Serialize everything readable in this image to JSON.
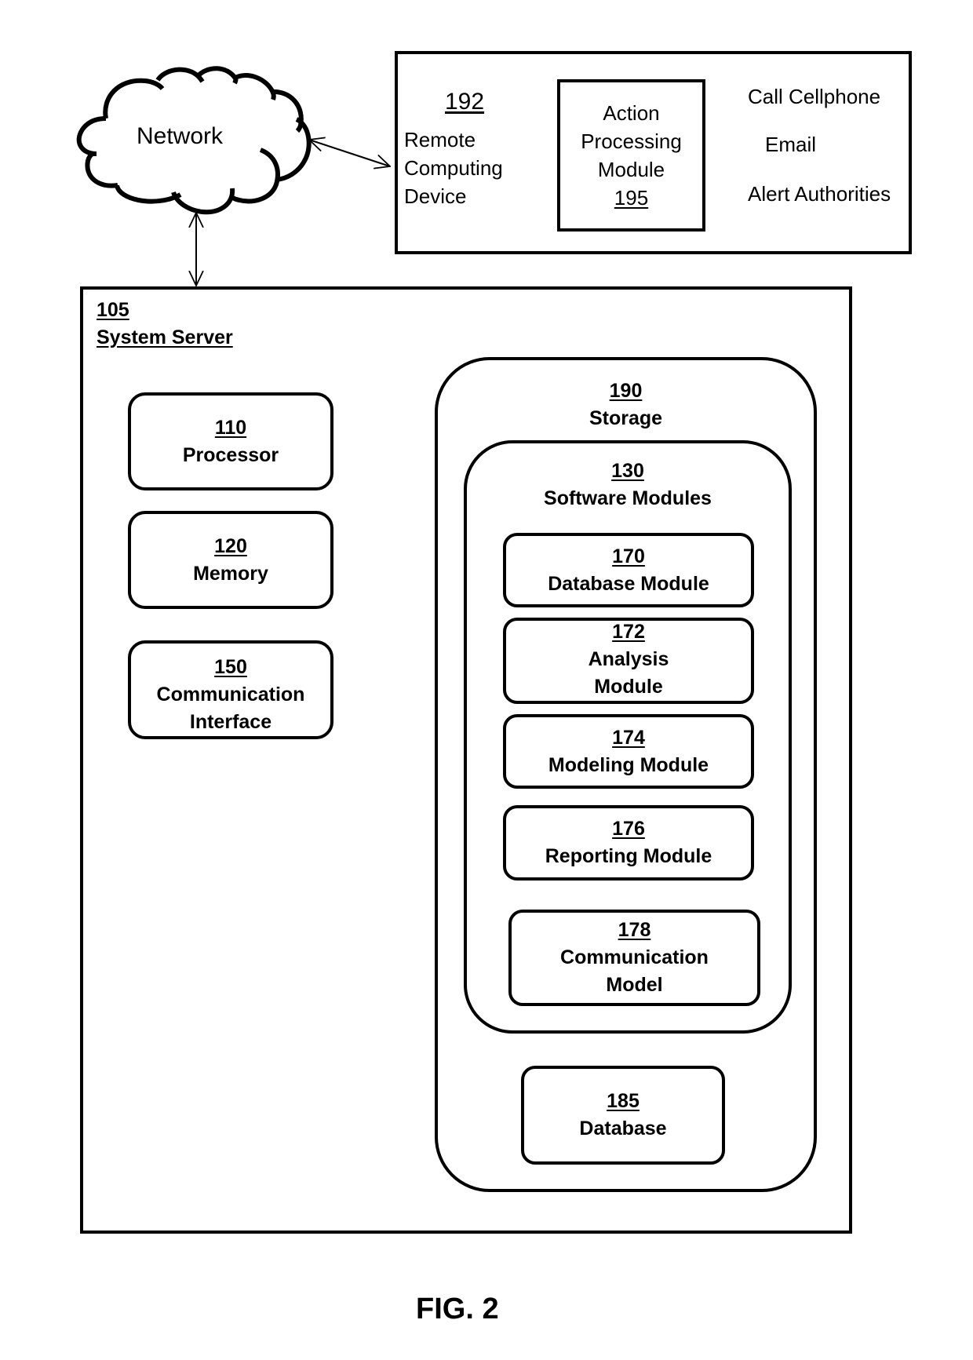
{
  "network": {
    "label": "Network"
  },
  "remote_device": {
    "number": "192",
    "label_lines": [
      "Remote",
      "Computing",
      "Device"
    ]
  },
  "action_module": {
    "label_lines": [
      "Action",
      "Processing",
      "Module"
    ],
    "number": "195",
    "outputs": [
      "Call Cellphone",
      "Email",
      "Alert Authorities"
    ]
  },
  "system_server": {
    "number": "105",
    "label": "System Server",
    "components": [
      {
        "number": "110",
        "label": "Processor"
      },
      {
        "number": "120",
        "label": "Memory"
      },
      {
        "number": "150",
        "label": "Communication Interface"
      }
    ],
    "storage": {
      "number": "190",
      "label": "Storage",
      "software_modules": {
        "number": "130",
        "label": "Software Modules",
        "modules": [
          {
            "number": "170",
            "label": "Database Module"
          },
          {
            "number": "172",
            "label": "Analysis Module"
          },
          {
            "number": "174",
            "label": "Modeling Module"
          },
          {
            "number": "176",
            "label": "Reporting Module"
          },
          {
            "number": "178",
            "label": "Communication Model"
          }
        ]
      },
      "database": {
        "number": "185",
        "label": "Database"
      }
    }
  },
  "figure_caption": "FIG. 2"
}
